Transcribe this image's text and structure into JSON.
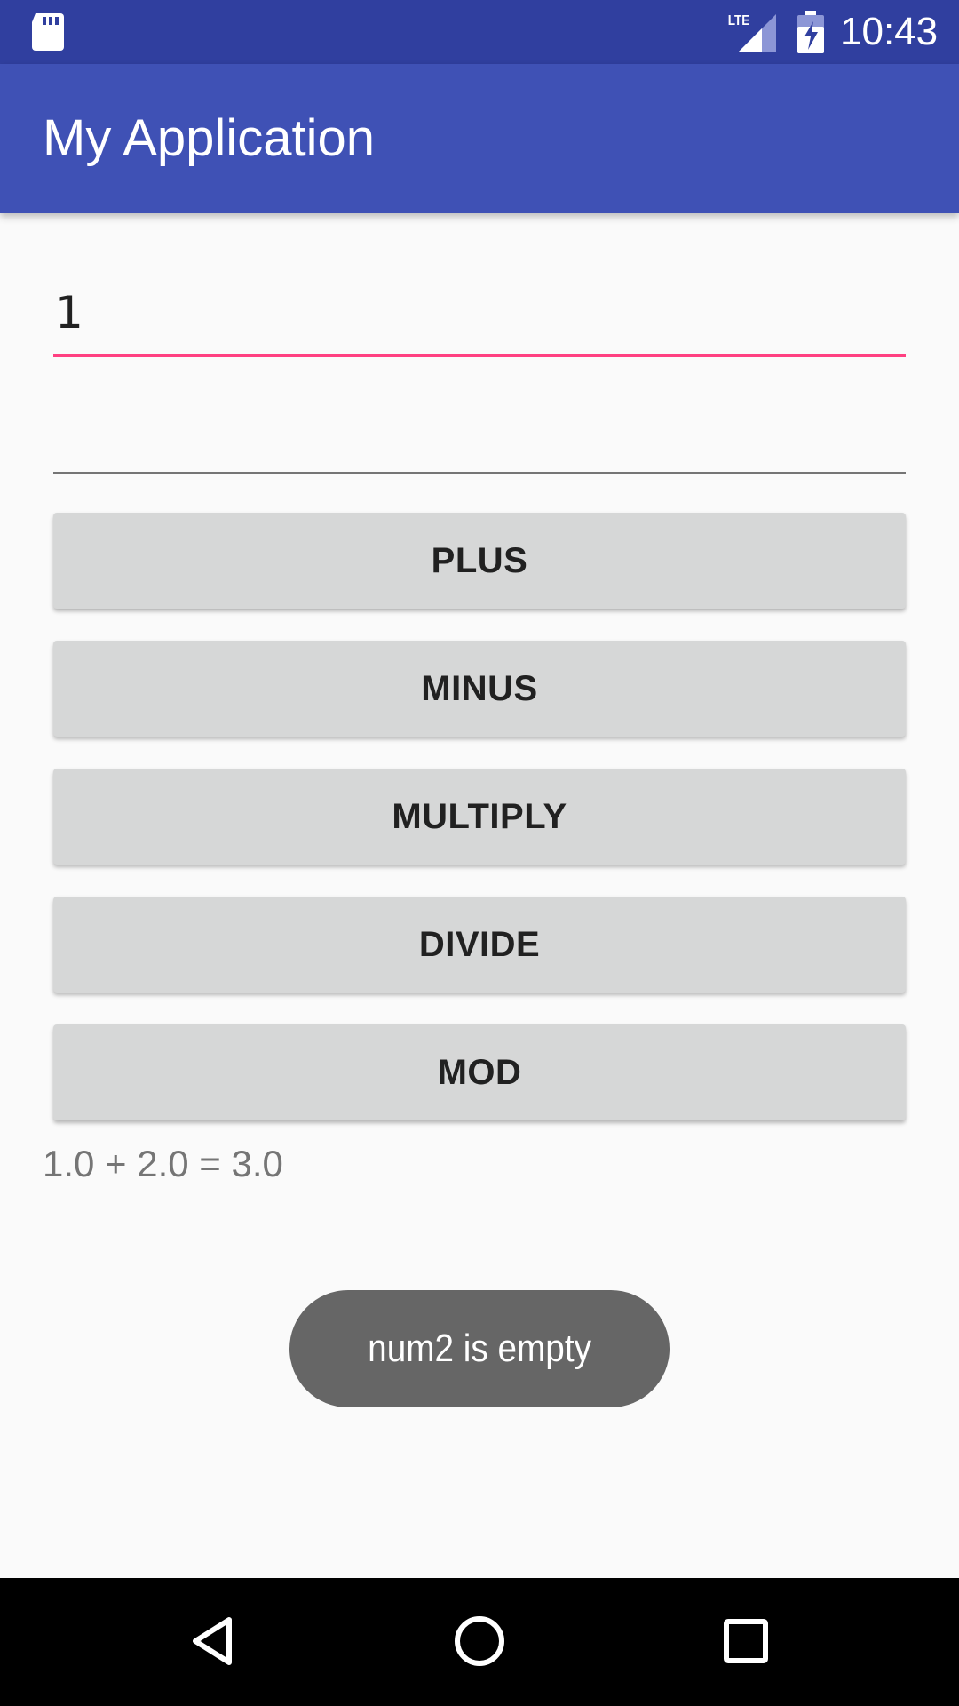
{
  "status_bar": {
    "time": "10:43",
    "network": "LTE",
    "icons": [
      "sd-card-icon",
      "lte-signal-icon",
      "battery-charging-icon"
    ]
  },
  "app_bar": {
    "title": "My Application"
  },
  "inputs": {
    "num1_value": "1",
    "num2_value": ""
  },
  "buttons": {
    "plus": "PLUS",
    "minus": "MINUS",
    "multiply": "MULTIPLY",
    "divide": "DIVIDE",
    "mod": "MOD"
  },
  "result": {
    "text": "1.0 + 2.0 = 3.0"
  },
  "toast": {
    "message": "num2 is empty"
  },
  "nav_bar": {
    "icons": [
      "back-icon",
      "home-icon",
      "recents-icon"
    ]
  },
  "colors": {
    "status_bar": "#303f9f",
    "app_bar": "#3f51b5",
    "accent": "#ff4081",
    "button": "#d6d7d7",
    "toast": "#666666"
  }
}
